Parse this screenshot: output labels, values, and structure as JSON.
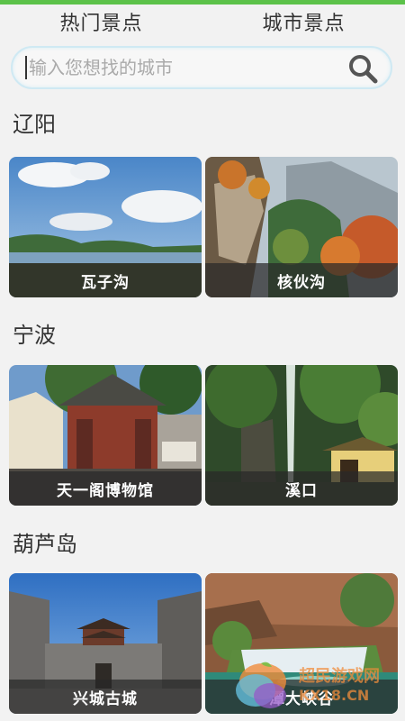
{
  "tabs": [
    {
      "label": "热门景点"
    },
    {
      "label": "城市景点"
    }
  ],
  "search": {
    "placeholder": "输入您想找的城市",
    "icon": "search-icon"
  },
  "sections": [
    {
      "title": "辽阳",
      "cards": [
        {
          "label": "瓦子沟"
        },
        {
          "label": "核伙沟"
        }
      ]
    },
    {
      "title": "宁波",
      "cards": [
        {
          "label": "天一阁博物馆"
        },
        {
          "label": "溪口"
        }
      ]
    },
    {
      "title": "葫芦岛",
      "cards": [
        {
          "label": "兴城古城"
        },
        {
          "label": "潭大峡谷"
        }
      ]
    }
  ],
  "watermark": {
    "text": "超民游戏网",
    "url": "KX18.CN"
  },
  "colors": {
    "accent": "#5cc24a",
    "background": "#f2f2f2",
    "caption_bg": "#282828"
  }
}
